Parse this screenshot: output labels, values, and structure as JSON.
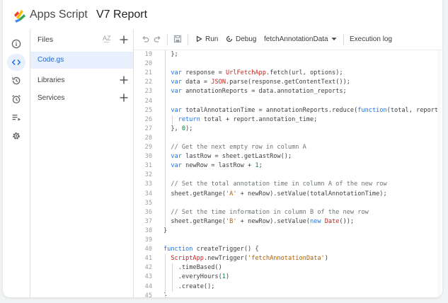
{
  "header": {
    "app_name": "Apps Script",
    "project_title": "V7 Report"
  },
  "rail": {
    "items": [
      "overview-icon",
      "editor-icon",
      "triggers-icon",
      "executions-icon",
      "run-list-icon",
      "settings-icon"
    ],
    "active": "editor-icon"
  },
  "files_panel": {
    "files_label": "Files",
    "sort_label": "A͟Z",
    "file_name": "Code.gs",
    "libraries_label": "Libraries",
    "services_label": "Services"
  },
  "toolbar": {
    "run_label": "Run",
    "debug_label": "Debug",
    "function_select": "fetchAnnotationData",
    "execution_log_label": "Execution log"
  },
  "code": {
    "lines": [
      {
        "n": "19",
        "t": "  };"
      },
      {
        "n": "20",
        "t": ""
      },
      {
        "n": "21",
        "t": "  var response = UrlFetchApp.fetch(url, options);"
      },
      {
        "n": "22",
        "t": "  var data = JSON.parse(response.getContentText());"
      },
      {
        "n": "23",
        "t": "  var annotationReports = data.annotation_reports;"
      },
      {
        "n": "24",
        "t": ""
      },
      {
        "n": "25",
        "t": "  var totalAnnotationTime = annotationReports.reduce(function(total, report) {"
      },
      {
        "n": "26",
        "t": "    return total + report.annotation_time;"
      },
      {
        "n": "27",
        "t": "  }, 0);"
      },
      {
        "n": "28",
        "t": ""
      },
      {
        "n": "29",
        "t": "  // Get the next empty row in column A"
      },
      {
        "n": "30",
        "t": "  var lastRow = sheet.getLastRow();"
      },
      {
        "n": "31",
        "t": "  var newRow = lastRow + 1;"
      },
      {
        "n": "32",
        "t": ""
      },
      {
        "n": "33",
        "t": "  // Set the total annotation time in column A of the new row"
      },
      {
        "n": "34",
        "t": "  sheet.getRange('A' + newRow).setValue(totalAnnotationTime);"
      },
      {
        "n": "35",
        "t": ""
      },
      {
        "n": "36",
        "t": "  // Set the time information in column B of the new row"
      },
      {
        "n": "37",
        "t": "  sheet.getRange('B' + newRow).setValue(new Date());"
      },
      {
        "n": "38",
        "t": "}"
      },
      {
        "n": "39",
        "t": ""
      },
      {
        "n": "40",
        "t": "function createTrigger() {"
      },
      {
        "n": "41",
        "t": "  ScriptApp.newTrigger('fetchAnnotationData')"
      },
      {
        "n": "42",
        "t": "    .timeBased()"
      },
      {
        "n": "43",
        "t": "    .everyHours(1)"
      },
      {
        "n": "44",
        "t": "    .create();"
      },
      {
        "n": "45",
        "t": "}"
      }
    ]
  },
  "colors": {
    "accent": "#1a73e8",
    "active_bg": "#e8f0fe",
    "keyword": "#1a73e8",
    "string": "#b15d00",
    "number": "#0b8043",
    "class": "#c5221f"
  }
}
